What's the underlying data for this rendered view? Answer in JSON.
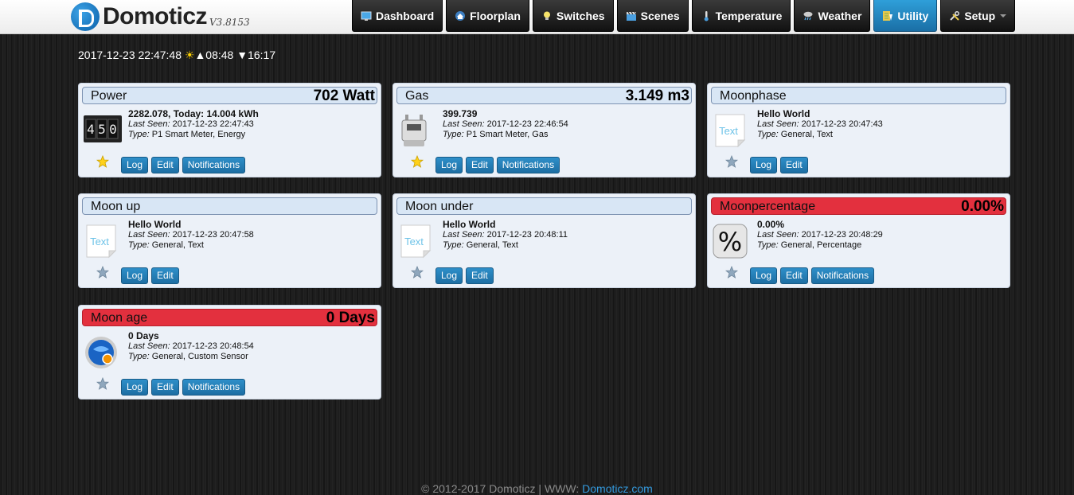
{
  "app": {
    "logo_name": "Domoticz",
    "version": "V3.8153"
  },
  "nav": [
    {
      "label": "Dashboard",
      "icon": "monitor-icon"
    },
    {
      "label": "Floorplan",
      "icon": "house-icon"
    },
    {
      "label": "Switches",
      "icon": "lightbulb-icon"
    },
    {
      "label": "Scenes",
      "icon": "clapperboard-icon"
    },
    {
      "label": "Temperature",
      "icon": "thermometer-icon"
    },
    {
      "label": "Weather",
      "icon": "cloud-rain-icon"
    },
    {
      "label": "Utility",
      "icon": "utility-icon",
      "active": true
    },
    {
      "label": "Setup",
      "icon": "tools-icon",
      "dropdown": true
    }
  ],
  "datetime": {
    "date": "2017-12-23 22:47:48",
    "sunrise": "▲08:48",
    "sunset": "▼16:17"
  },
  "labels": {
    "last_seen": "Last Seen:",
    "type": "Type:",
    "log": "Log",
    "edit": "Edit",
    "notifications": "Notifications"
  },
  "devices": [
    {
      "name": "Power",
      "value": "702 Watt",
      "data": "2282.078, Today: 14.004 kWh",
      "last_seen": "2017-12-23 22:47:43",
      "type": "P1 Smart Meter, Energy",
      "icon": "counter-icon",
      "favorite": true,
      "notifications": true,
      "red": false
    },
    {
      "name": "Gas",
      "value": "3.149 m3",
      "data": "399.739",
      "last_seen": "2017-12-23 22:46:54",
      "type": "P1 Smart Meter, Gas",
      "icon": "gas-meter-icon",
      "favorite": true,
      "notifications": true,
      "red": false
    },
    {
      "name": "Moonphase",
      "value": "",
      "data": "Hello World",
      "last_seen": "2017-12-23 20:47:43",
      "type": "General, Text",
      "icon": "text-icon",
      "favorite": false,
      "notifications": false,
      "red": false
    },
    {
      "name": "Moon up",
      "value": "",
      "data": "Hello World",
      "last_seen": "2017-12-23 20:47:58",
      "type": "General, Text",
      "icon": "text-icon",
      "favorite": false,
      "notifications": false,
      "red": false
    },
    {
      "name": "Moon under",
      "value": "",
      "data": "Hello World",
      "last_seen": "2017-12-23 20:48:11",
      "type": "General, Text",
      "icon": "text-icon",
      "favorite": false,
      "notifications": false,
      "red": false
    },
    {
      "name": "Moonpercentage",
      "value": "0.00%",
      "data": "0.00%",
      "last_seen": "2017-12-23 20:48:29",
      "type": "General, Percentage",
      "icon": "percent-icon",
      "favorite": false,
      "notifications": true,
      "red": true
    },
    {
      "name": "Moon age",
      "value": "0 Days",
      "data": "0 Days",
      "last_seen": "2017-12-23 20:48:54",
      "type": "General, Custom Sensor",
      "icon": "custom-sensor-icon",
      "favorite": false,
      "notifications": true,
      "red": true
    }
  ],
  "icon_text_label": "Text",
  "icon_counter_digits": [
    "4",
    "5",
    "0"
  ],
  "footer": {
    "text": "© 2012-2017 Domoticz | WWW: ",
    "link": "Domoticz.com"
  }
}
